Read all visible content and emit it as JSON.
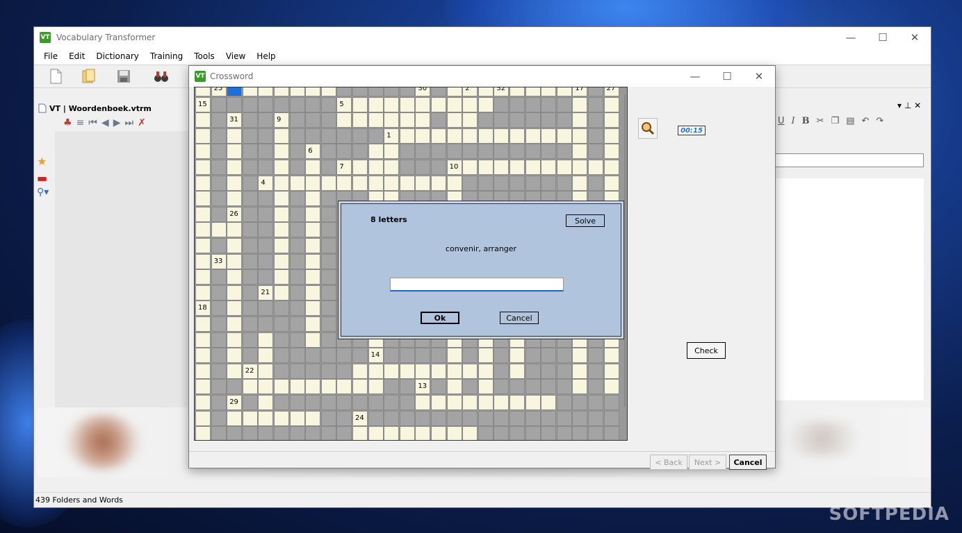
{
  "main_window": {
    "title": "Vocabulary Transformer",
    "menu": [
      "File",
      "Edit",
      "Dictionary",
      "Training",
      "Tools",
      "View",
      "Help"
    ],
    "document_title": "VT | Woordenboek.vtrm",
    "status_text": "439 Folders and Words"
  },
  "crossword": {
    "title": "Crossword",
    "timer": "00:15",
    "check_label": "Check",
    "back_label": "< Back",
    "next_label": "Next >",
    "cancel_label": "Cancel",
    "clue_numbers": [
      {
        "n": "25"
      },
      {
        "n": "30"
      },
      {
        "n": "2"
      },
      {
        "n": "32"
      },
      {
        "n": "17"
      },
      {
        "n": "27"
      },
      {
        "n": "15"
      },
      {
        "n": "5"
      },
      {
        "n": "31"
      },
      {
        "n": "9"
      },
      {
        "n": "1"
      },
      {
        "n": "6"
      },
      {
        "n": "7"
      },
      {
        "n": "10"
      },
      {
        "n": "4"
      },
      {
        "n": "26"
      },
      {
        "n": "33"
      },
      {
        "n": "21"
      },
      {
        "n": "18"
      },
      {
        "n": "14"
      },
      {
        "n": "22"
      },
      {
        "n": "13"
      },
      {
        "n": "29"
      },
      {
        "n": "24"
      }
    ]
  },
  "answer_dialog": {
    "letters_label": "8 letters",
    "solve_label": "Solve",
    "clue": "convenir, arranger",
    "input_value": "",
    "ok_label": "Ok",
    "cancel_label": "Cancel"
  },
  "watermark": "SOFTPEDIA"
}
